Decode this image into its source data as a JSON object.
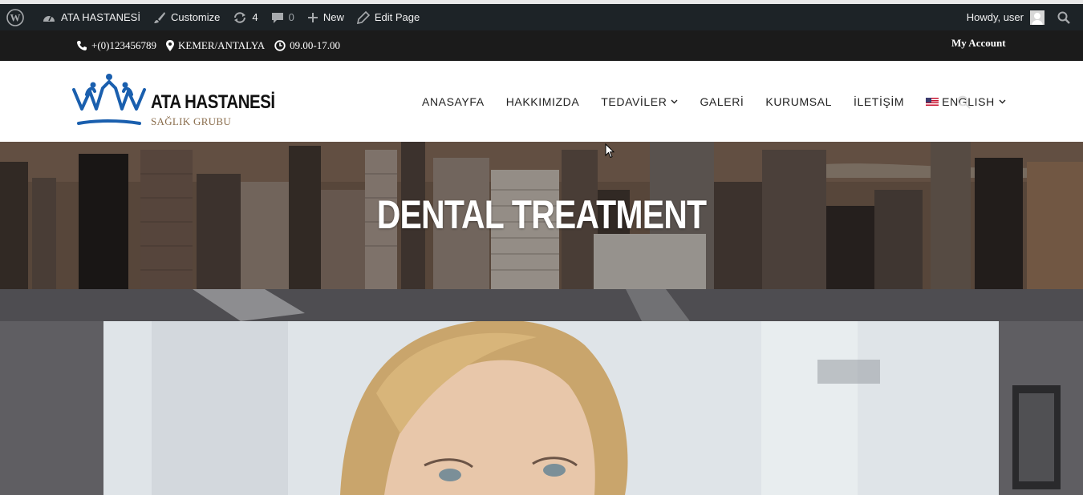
{
  "admin_bar": {
    "site_name": "ATA HASTANESİ",
    "customize": "Customize",
    "updates_count": "4",
    "comments_count": "0",
    "new_label": "New",
    "edit_page": "Edit Page",
    "howdy": "Howdy, user"
  },
  "contact_bar": {
    "phone": "+(0)123456789",
    "location": "KEMER/ANTALYA",
    "hours": "09.00-17.00",
    "my_account": "My Account"
  },
  "header": {
    "logo_title": "ATA HASTANESİ",
    "logo_subtitle": "SAĞLIK GRUBU",
    "nav": [
      {
        "label": "ANASAYFA"
      },
      {
        "label": "HAKKIMIZDA"
      },
      {
        "label": "TEDAVİLER"
      },
      {
        "label": "GALERİ"
      },
      {
        "label": "KURUMSAL"
      },
      {
        "label": "İLETİŞİM"
      },
      {
        "label": "ENGLISH"
      }
    ]
  },
  "hero": {
    "title": "DENTAL TREATMENT"
  },
  "colors": {
    "admin_bar_bg": "#1d2327",
    "contact_bar_bg": "#1b1b1b",
    "logo_blue": "#1a5fae",
    "logo_subtitle": "#8a6d4c"
  }
}
